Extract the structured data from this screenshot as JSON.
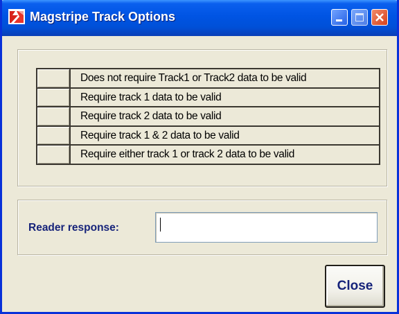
{
  "window": {
    "title": "Magstripe Track Options",
    "accent_color": "#0054e3",
    "background_color": "#ece9d8",
    "icon": "app-logo-icon",
    "controls": [
      "minimize-icon",
      "maximize-icon",
      "close-icon"
    ]
  },
  "options": [
    {
      "label": "Does not require Track1 or Track2 data to be valid"
    },
    {
      "label": "Require track 1  data to be valid"
    },
    {
      "label": "Require track 2 data to be valid"
    },
    {
      "label": "Require track 1 & 2 data to be valid"
    },
    {
      "label": "Require either track 1 or track 2 data to be valid"
    }
  ],
  "reader": {
    "label": "Reader response:",
    "value": ""
  },
  "buttons": {
    "close_label": "Close"
  }
}
